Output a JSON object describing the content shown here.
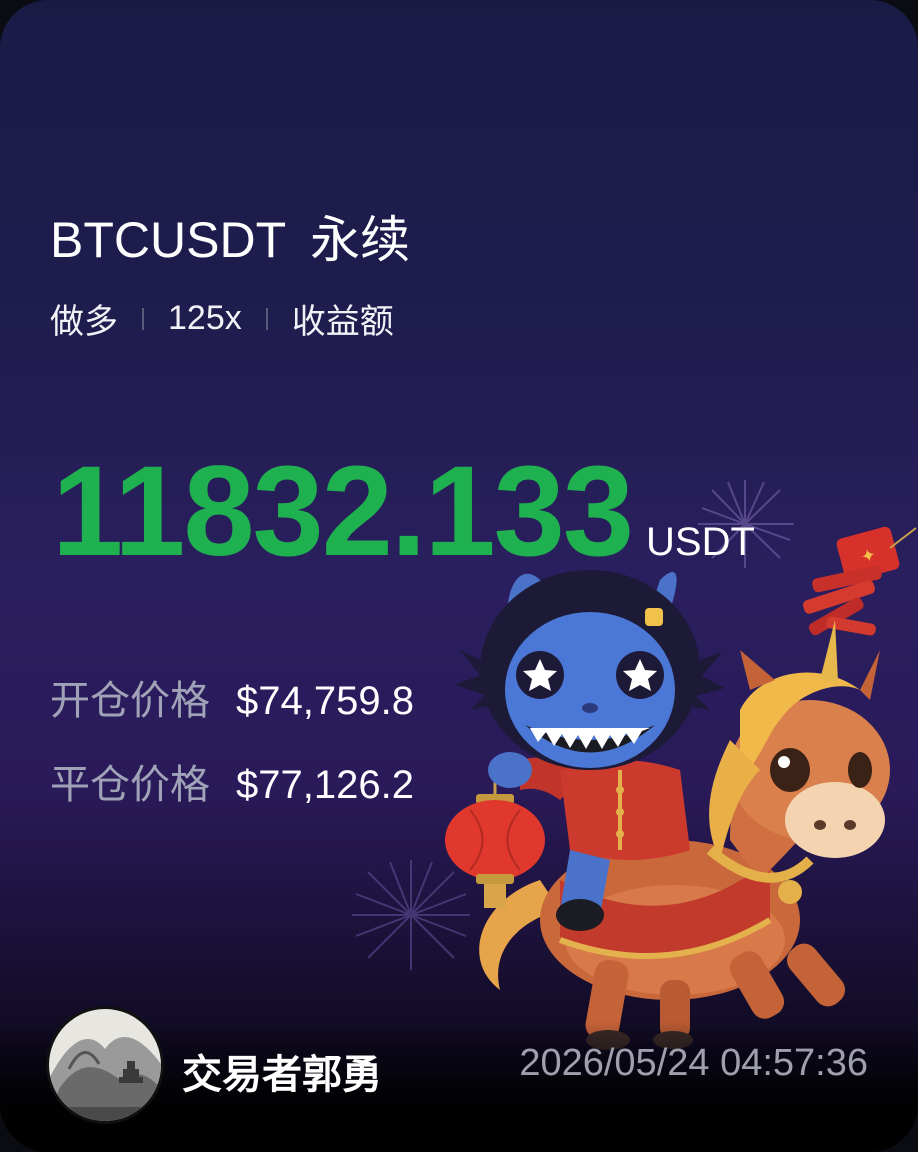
{
  "pair": "BTCUSDT",
  "contract_type": "永续",
  "direction": "做多",
  "leverage": "125x",
  "metric_label": "收益额",
  "pnl": {
    "amount": "11832.133",
    "unit": "USDT"
  },
  "open_price": {
    "label": "开仓价格",
    "value": "$74,759.8"
  },
  "close_price": {
    "label": "平仓价格",
    "value": "$77,126.2"
  },
  "trader": {
    "name": "交易者郭勇"
  },
  "timestamp": "2026/05/24 04:57:36",
  "colors": {
    "profit": "#1fb14f",
    "background_top": "#191b45",
    "background_mid": "#2a1f5e",
    "label_gray": "#a0a3b8"
  }
}
